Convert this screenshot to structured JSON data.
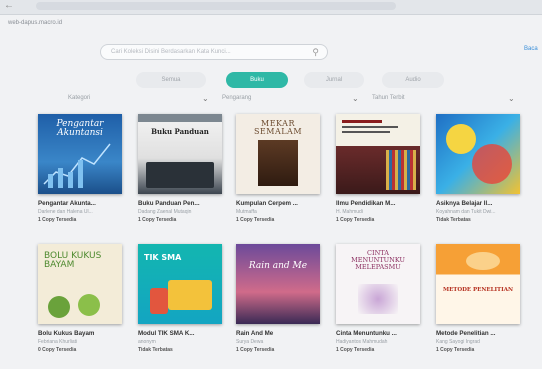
{
  "browser": {
    "url": "web-dapus.macro.id"
  },
  "search": {
    "placeholder": "Cari Koleksi Disini Berdasarkan Kata Kunci..."
  },
  "header_link": "Baca",
  "tabs": [
    {
      "label": "Semua",
      "active": false
    },
    {
      "label": "Buku",
      "active": true
    },
    {
      "label": "Jurnal",
      "active": false
    },
    {
      "label": "Audio",
      "active": false
    }
  ],
  "filters": {
    "category": "Kategori",
    "author": "Pengarang",
    "year": "Tahun Terbit"
  },
  "colors": {
    "accent": "#2fb8a6"
  },
  "books": [
    {
      "title": "Pengantar Akunta...",
      "author": "Darlene dan Halena Ul...",
      "stock": "1 Copy Tersedia",
      "cover_text": "Pengantar Akuntansi"
    },
    {
      "title": "Buku Panduan Pen...",
      "author": "Dadang Zaenal Mutaqin",
      "stock": "1 Copy Tersedia",
      "cover_text": "Buku Panduan"
    },
    {
      "title": "Kumpulan Cerpem ...",
      "author": "Mutmaffa",
      "stock": "1 Copy Tersedia",
      "cover_text": "MEKAR SEMALAM"
    },
    {
      "title": "Ilmu Pendidikan M...",
      "author": "H. Mahmudi",
      "stock": "1 Copy Tersedia",
      "cover_text": ""
    },
    {
      "title": "Asiknya Belajar Il...",
      "author": "Koyahnam dan Tukit Dwi...",
      "stock": "Tidak Terbatas",
      "cover_text": ""
    },
    {
      "title": "Bolu Kukus Bayam",
      "author": "Febriana Khurliati",
      "stock": "0 Copy Tersedia",
      "cover_text": "BOLU KUKUS BAYAM"
    },
    {
      "title": "Modul TIK SMA K...",
      "author": "anonym",
      "stock": "Tidak Terbatas",
      "cover_text": "TIK SMA"
    },
    {
      "title": "Rain And Me",
      "author": "Surya Dewa",
      "stock": "1 Copy Tersedia",
      "cover_text": "Rain and Me"
    },
    {
      "title": "Cinta Menuntunku ...",
      "author": "Hadiyantos Mahmudah",
      "stock": "1 Copy Tersedia",
      "cover_text": "CINTA MENUNTUNKU MELEPASMU"
    },
    {
      "title": "Metode Penelitian ...",
      "author": "Kang Sayogi Ingrad",
      "stock": "1 Copy Tersedia",
      "cover_text": "METODE PENELITIAN"
    }
  ]
}
